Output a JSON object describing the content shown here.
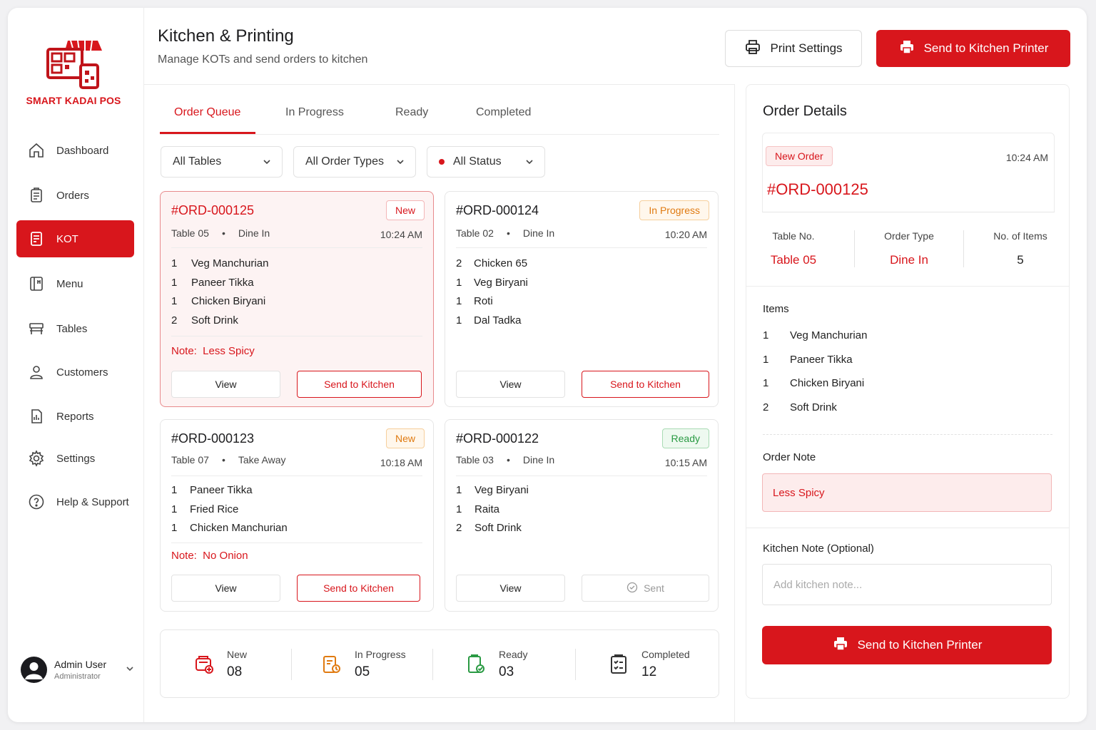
{
  "brand": {
    "name": "SMART KADAI POS",
    "accent": "#d8161c"
  },
  "sidebar": {
    "items": [
      {
        "label": "Dashboard",
        "icon": "home-icon"
      },
      {
        "label": "Orders",
        "icon": "clipboard-icon"
      },
      {
        "label": "KOT",
        "icon": "receipt-icon",
        "active": true
      },
      {
        "label": "Menu",
        "icon": "menu-book-icon"
      },
      {
        "label": "Tables",
        "icon": "table-icon"
      },
      {
        "label": "Customers",
        "icon": "user-icon"
      },
      {
        "label": "Reports",
        "icon": "report-icon"
      },
      {
        "label": "Settings",
        "icon": "gear-icon"
      },
      {
        "label": "Help & Support",
        "icon": "help-icon"
      }
    ],
    "user": {
      "name": "Admin User",
      "role": "Administrator"
    }
  },
  "header": {
    "title": "Kitchen & Printing",
    "subtitle": "Manage KOTs and send orders to kitchen",
    "print_settings": "Print Settings",
    "send_printer": "Send to Kitchen Printer"
  },
  "tabs": [
    {
      "label": "Order Queue",
      "active": true
    },
    {
      "label": "In Progress"
    },
    {
      "label": "Ready"
    },
    {
      "label": "Completed"
    }
  ],
  "filters": {
    "tables": "All Tables",
    "order_types": "All Order Types",
    "status": "All Status"
  },
  "orders": [
    {
      "id": "#ORD-000125",
      "badge": "New",
      "table": "Table 05",
      "type": "Dine In",
      "time": "10:24 AM",
      "items": [
        {
          "qty": "1",
          "name": "Veg Manchurian"
        },
        {
          "qty": "1",
          "name": "Paneer Tikka"
        },
        {
          "qty": "1",
          "name": "Chicken Biryani"
        },
        {
          "qty": "2",
          "name": "Soft Drink"
        }
      ],
      "note": "Note:  Less Spicy",
      "view": "View",
      "action": "Send to Kitchen"
    },
    {
      "id": "#ORD-000124",
      "badge": "In Progress",
      "table": "Table 02",
      "type": "Dine In",
      "time": "10:20 AM",
      "items": [
        {
          "qty": "2",
          "name": "Chicken 65"
        },
        {
          "qty": "1",
          "name": "Veg Biryani"
        },
        {
          "qty": "1",
          "name": "Roti"
        },
        {
          "qty": "1",
          "name": "Dal Tadka"
        }
      ],
      "view": "View",
      "action": "Send to Kitchen"
    },
    {
      "id": "#ORD-000123",
      "badge": "New",
      "table": "Table 07",
      "type": "Take Away",
      "time": "10:18 AM",
      "items": [
        {
          "qty": "1",
          "name": "Paneer Tikka"
        },
        {
          "qty": "1",
          "name": "Fried Rice"
        },
        {
          "qty": "1",
          "name": "Chicken Manchurian"
        }
      ],
      "note": "Note:  No Onion",
      "view": "View",
      "action": "Send to Kitchen"
    },
    {
      "id": "#ORD-000122",
      "badge": "Ready",
      "table": "Table 03",
      "type": "Dine In",
      "time": "10:15 AM",
      "items": [
        {
          "qty": "1",
          "name": "Veg Biryani"
        },
        {
          "qty": "1",
          "name": "Raita"
        },
        {
          "qty": "2",
          "name": "Soft Drink"
        }
      ],
      "view": "View",
      "action": "Sent"
    }
  ],
  "stats": [
    {
      "label": "New",
      "value": "08",
      "color": "#d8161c"
    },
    {
      "label": "In Progress",
      "value": "05",
      "color": "#e07a10"
    },
    {
      "label": "Ready",
      "value": "03",
      "color": "#2a9a43"
    },
    {
      "label": "Completed",
      "value": "12",
      "color": "#333333"
    }
  ],
  "details": {
    "title": "Order Details",
    "badge": "New Order",
    "time": "10:24 AM",
    "id": "#ORD-000125",
    "table_label": "Table No.",
    "table_value": "Table 05",
    "type_label": "Order Type",
    "type_value": "Dine In",
    "count_label": "No. of Items",
    "count_value": "5",
    "items_label": "Items",
    "items": [
      {
        "qty": "1",
        "name": "Veg Manchurian"
      },
      {
        "qty": "1",
        "name": "Paneer Tikka"
      },
      {
        "qty": "1",
        "name": "Chicken Biryani"
      },
      {
        "qty": "2",
        "name": "Soft Drink"
      }
    ],
    "note_label": "Order Note",
    "note": "Less Spicy",
    "kitchen_note_label": "Kitchen Note (Optional)",
    "kitchen_note_placeholder": "Add kitchen note...",
    "send_button": "Send to Kitchen Printer"
  }
}
